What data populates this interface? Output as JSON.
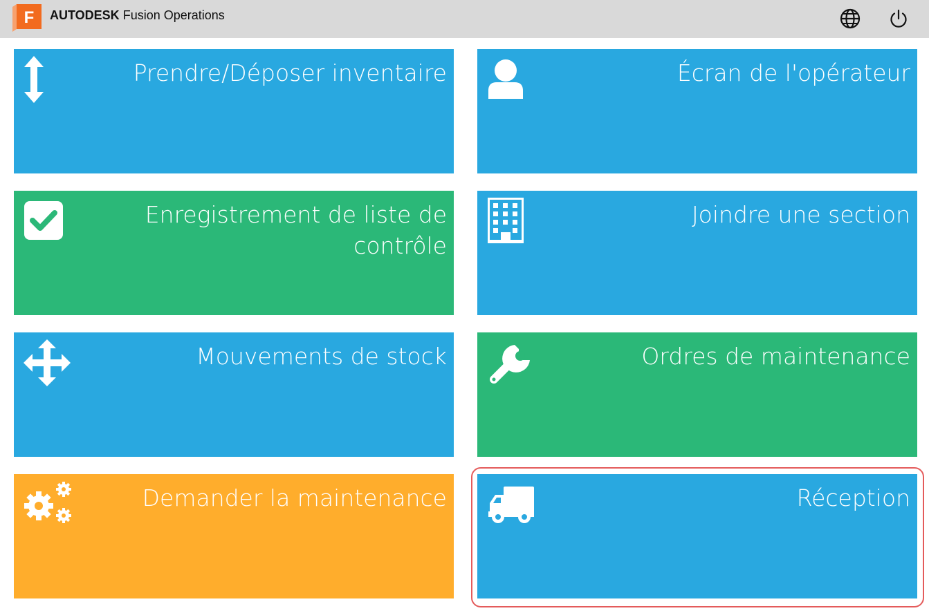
{
  "header": {
    "brand_prefix": "AUTODESK",
    "brand_suffix": "Fusion Operations",
    "logo_letter": "F",
    "globe_icon": "globe-icon",
    "power_icon": "power-icon"
  },
  "tiles": [
    {
      "label": "Prendre/Déposer inventaire",
      "icon": "vertical-arrows-icon",
      "color": "#29a8e0"
    },
    {
      "label": "Écran de l'opérateur",
      "icon": "user-icon",
      "color": "#29a8e0"
    },
    {
      "label": "Enregistrement de liste de contrôle",
      "icon": "checkbox-icon",
      "color": "#2bb878"
    },
    {
      "label": "Joindre une section",
      "icon": "building-icon",
      "color": "#29a8e0"
    },
    {
      "label": "Mouvements de stock",
      "icon": "move-arrows-icon",
      "color": "#29a8e0"
    },
    {
      "label": "Ordres de maintenance",
      "icon": "wrench-icon",
      "color": "#2bb878"
    },
    {
      "label": "Demander la maintenance",
      "icon": "gears-icon",
      "color": "#ffad2c"
    },
    {
      "label": "Réception",
      "icon": "truck-icon",
      "color": "#29a8e0"
    }
  ],
  "colors": {
    "blue": "#29a8e0",
    "green": "#2bb878",
    "orange": "#ffad2c",
    "topbar": "#d9d9d9",
    "highlight": "#e45b5b"
  }
}
